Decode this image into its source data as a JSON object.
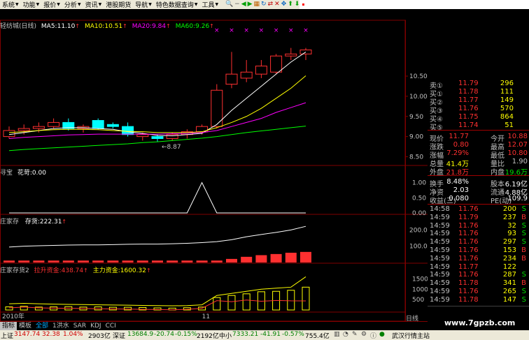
{
  "colors": {
    "up": "#ff3030",
    "down": "#00ffff",
    "ma5": "#ffffff",
    "ma10": "#ffff00",
    "ma20": "#ff00ff",
    "ma60": "#00ff00",
    "grid": "#800000",
    "axis": "#c0c0c0",
    "neutral": "#ffffff",
    "green": "#00e000",
    "yellow": "#ffff00"
  },
  "menu": {
    "items": [
      {
        "label": "系统",
        "arrow": "▼"
      },
      {
        "label": "功能",
        "arrow": "▼"
      },
      {
        "label": "报价",
        "arrow": "▼"
      },
      {
        "label": "分析",
        "arrow": "▼"
      },
      {
        "label": "资讯",
        "arrow": "▼"
      },
      {
        "label": "港股期货",
        "arrow": ""
      },
      {
        "label": "导航",
        "arrow": "▼"
      },
      {
        "label": "特色数据查询",
        "arrow": "▼"
      },
      {
        "label": "工具",
        "arrow": "▼"
      }
    ],
    "toolbar_icons": [
      {
        "name": "search-icon",
        "glyph": "🔍"
      },
      {
        "name": "zoom-out-icon",
        "glyph": "−"
      },
      {
        "name": "back-icon",
        "glyph": "◀"
      },
      {
        "name": "forward-icon",
        "glyph": "▶"
      },
      {
        "name": "chart-icon",
        "glyph": "▦"
      },
      {
        "name": "refresh-icon",
        "glyph": "↻"
      },
      {
        "name": "transfer-icon",
        "glyph": "⇄"
      },
      {
        "name": "lock-icon",
        "glyph": "✕"
      },
      {
        "name": "expand-icon",
        "glyph": "✥"
      },
      {
        "name": "up-arrow-icon",
        "glyph": "⬆"
      },
      {
        "name": "down-arrow-icon",
        "glyph": "⬇"
      },
      {
        "name": "menu-icon",
        "glyph": "☰"
      }
    ]
  },
  "main": {
    "title": "轻纺城(日线)",
    "ma5": "MA5:11.10",
    "ma10": "MA10:10.51",
    "ma20": "MA20:9.84",
    "ma60": "MA60:9.26",
    "low_marker": "←8.87"
  },
  "ind1": {
    "name": "寻宝",
    "value": "花苛:0.00"
  },
  "ind2": {
    "name": "庄家存",
    "value": "存货:222.31"
  },
  "ind3": {
    "name": "庄家存货2",
    "value1": "拉升资金:438.74",
    "value2": "主力资金:1600.32"
  },
  "xaxis": {
    "label_left": "2010年",
    "label_mid": "11",
    "label_right": "日线"
  },
  "chart_data": {
    "type": "candlestick",
    "title": "轻纺城(日线)",
    "ohlc": [
      [
        9.0,
        9.25,
        8.95,
        9.15
      ],
      [
        9.15,
        9.3,
        9.05,
        9.2
      ],
      [
        9.2,
        9.35,
        9.1,
        9.25
      ],
      [
        9.25,
        9.45,
        9.2,
        9.35
      ],
      [
        9.35,
        9.45,
        9.15,
        9.2
      ],
      [
        9.2,
        9.3,
        9.1,
        9.25
      ],
      [
        9.4,
        9.45,
        9.18,
        9.2
      ],
      [
        9.3,
        9.35,
        9.2,
        9.25
      ],
      [
        9.25,
        9.35,
        9.0,
        9.05
      ],
      [
        9.0,
        9.1,
        8.9,
        9.05
      ],
      [
        9.0,
        9.05,
        8.87,
        8.95
      ],
      [
        8.95,
        9.1,
        8.9,
        9.05
      ],
      [
        9.05,
        9.18,
        8.95,
        9.12
      ],
      [
        9.12,
        9.3,
        9.05,
        9.25
      ],
      [
        9.25,
        10.3,
        9.2,
        10.15
      ],
      [
        10.3,
        11.1,
        10.2,
        10.55
      ],
      [
        10.45,
        10.9,
        10.35,
        10.6
      ],
      [
        10.55,
        10.9,
        10.45,
        10.75
      ],
      [
        10.6,
        11.05,
        10.55,
        11.0
      ],
      [
        11.0,
        11.2,
        10.9,
        11.05
      ],
      [
        11.05,
        11.2,
        10.9,
        11.15
      ]
    ],
    "ma5": [
      9.05,
      9.1,
      9.15,
      9.2,
      9.22,
      9.22,
      9.2,
      9.18,
      9.12,
      9.08,
      9.03,
      9.02,
      9.05,
      9.08,
      9.3,
      9.65,
      9.95,
      10.25,
      10.55,
      10.85,
      11.1
    ],
    "ma10": [
      9.1,
      9.12,
      9.15,
      9.17,
      9.18,
      9.18,
      9.17,
      9.15,
      9.13,
      9.12,
      9.1,
      9.1,
      9.1,
      9.12,
      9.22,
      9.35,
      9.5,
      9.7,
      9.95,
      10.2,
      10.51
    ],
    "ma20": [
      8.95,
      8.98,
      9.0,
      9.02,
      9.04,
      9.05,
      9.06,
      9.06,
      9.06,
      9.06,
      9.06,
      9.07,
      9.08,
      9.1,
      9.15,
      9.25,
      9.35,
      9.45,
      9.6,
      9.72,
      9.84
    ],
    "ma60": [
      8.65,
      8.68,
      8.7,
      8.72,
      8.74,
      8.76,
      8.78,
      8.8,
      8.82,
      8.85,
      8.87,
      8.9,
      8.93,
      8.96,
      9.0,
      9.05,
      9.1,
      9.14,
      9.18,
      9.22,
      9.26
    ],
    "price_ticks": [
      10.5,
      10.0,
      9.5,
      9.0,
      8.5
    ],
    "price_range": [
      8.3,
      11.35
    ],
    "ind1_series": [
      0,
      0,
      0,
      0,
      0,
      0,
      0,
      0,
      0,
      0,
      0,
      0,
      0,
      1,
      0,
      0,
      0,
      0,
      0,
      0,
      0
    ],
    "ind1_ticks": [
      1.0,
      0.5,
      0.0
    ],
    "ind1_range": [
      0,
      1.15
    ],
    "ind2_line": [
      95,
      100,
      103,
      105,
      107,
      108,
      108,
      110,
      112,
      113,
      113,
      115,
      118,
      122,
      128,
      140,
      158,
      172,
      185,
      200,
      222
    ],
    "ind2_bars": [
      12,
      12,
      12,
      12,
      12,
      12,
      12,
      12,
      12,
      12,
      12,
      12,
      12,
      12,
      12,
      22,
      35,
      45,
      52,
      60,
      65
    ],
    "ind2_ticks": [
      200.0,
      100.0
    ],
    "ind2_range": [
      0,
      240
    ],
    "ind3_line1": [
      300,
      320,
      300,
      280,
      270,
      260,
      250,
      240,
      230,
      220,
      210,
      200,
      210,
      250,
      700,
      800,
      900,
      1000,
      1050,
      1100,
      1600
    ],
    "ind3_line2": [
      100,
      140,
      100,
      90,
      80,
      70,
      60,
      50,
      40,
      30,
      20,
      10,
      30,
      80,
      450,
      400,
      480,
      420,
      460,
      440,
      439
    ],
    "ind3_bars": [
      150,
      180,
      140,
      150,
      160,
      140,
      150,
      130,
      130,
      120,
      100,
      90,
      110,
      140,
      600,
      700,
      780,
      880,
      900,
      950,
      1100
    ],
    "ind3_ticks": [
      1500,
      1000,
      500
    ],
    "ind3_range": [
      0,
      1750
    ]
  },
  "quote": {
    "order_book": [
      {
        "label": "卖①",
        "price": "11.79",
        "vol": "296"
      },
      {
        "label": "买①",
        "price": "11.78",
        "vol": "111"
      },
      {
        "label": "买②",
        "price": "11.77",
        "vol": "149"
      },
      {
        "label": "买③",
        "price": "11.76",
        "vol": "570"
      },
      {
        "label": "买④",
        "price": "11.75",
        "vol": "864"
      },
      {
        "label": "买⑤",
        "price": "11.74",
        "vol": "51"
      }
    ],
    "stats": [
      {
        "l1": "现价",
        "v1": "11.77",
        "l2": "今开",
        "v2": "10.88"
      },
      {
        "l1": "涨跌",
        "v1": "0.80",
        "l2": "最高",
        "v2": "12.07"
      },
      {
        "l1": "涨幅",
        "v1": "7.29%",
        "l2": "最低",
        "v2": "10.80"
      },
      {
        "l1": "总量",
        "v1": "41.4万",
        "l2": "量比",
        "v2": "1.90"
      },
      {
        "l1": "外盘",
        "v1": "21.8万",
        "l2": "内盘",
        "v2": "19.6万"
      }
    ],
    "stats2": [
      {
        "l1": "换手",
        "v1": "8.48%",
        "l2": "股本",
        "v2": "6.19亿"
      },
      {
        "l1": "净资",
        "v1": "2.03",
        "l2": "流通",
        "v2": "4.88亿"
      },
      {
        "l1": "收益(三)",
        "v1": "0.080",
        "l2": "PE(动)",
        "v2": "109.9"
      }
    ],
    "ticks": [
      {
        "time": "14:58",
        "price": "11.76",
        "vol": "200",
        "side": "S"
      },
      {
        "time": "14:59",
        "price": "11.79",
        "vol": "237",
        "side": "B"
      },
      {
        "time": "14:59",
        "price": "11.76",
        "vol": "32",
        "side": "S"
      },
      {
        "time": "14:59",
        "price": "11.76",
        "vol": "93",
        "side": "S"
      },
      {
        "time": "14:59",
        "price": "11.76",
        "vol": "297",
        "side": "S"
      },
      {
        "time": "14:59",
        "price": "11.76",
        "vol": "153",
        "side": "B"
      },
      {
        "time": "14:59",
        "price": "11.76",
        "vol": "234",
        "side": "B"
      },
      {
        "time": "14:59",
        "price": "11.77",
        "vol": "122",
        "side": ""
      },
      {
        "time": "14:59",
        "price": "11.76",
        "vol": "287",
        "side": "S"
      },
      {
        "time": "14:59",
        "price": "11.78",
        "vol": "341",
        "side": "B"
      },
      {
        "time": "14:59",
        "price": "11.76",
        "vol": "265",
        "side": "S"
      },
      {
        "time": "14:59",
        "price": "11.78",
        "vol": "147",
        "side": "S"
      }
    ]
  },
  "tabs": [
    {
      "label": "指标",
      "active": true
    },
    {
      "label": "模板",
      "active": false
    },
    {
      "label": "全部",
      "active": false,
      "blue": true
    },
    {
      "label": "1洪水",
      "active": false
    },
    {
      "label": "SAR",
      "active": false
    },
    {
      "label": "KDJ",
      "active": false
    },
    {
      "label": "CCI",
      "active": false
    }
  ],
  "watermark": "www.7gpzb.com",
  "status": {
    "sh_label": "上证",
    "sh_value": "3147.74",
    "sh_change": "32.38",
    "sh_pct": "1.04%",
    "sh_amount": "2903亿",
    "sz_label": "深证",
    "sz_value": "13684.9",
    "sz_change": "-20.74",
    "sz_pct": "-0.15%",
    "sz_amount": "2192亿",
    "zx_label": "中小",
    "zx_value": "7333.21",
    "zx_change": "-41.91",
    "zx_pct": "-0.57%",
    "zx_amount": "755.4亿",
    "station": "武汉行情主站"
  }
}
